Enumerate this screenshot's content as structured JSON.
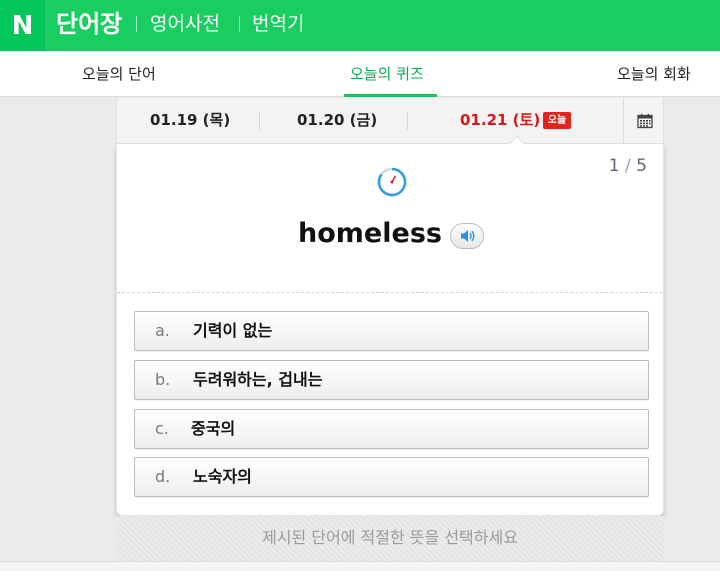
{
  "header": {
    "logo": "N",
    "title": "단어장",
    "links": [
      "영어사전",
      "번역기"
    ]
  },
  "subnav": {
    "items": [
      "오늘의 단어",
      "오늘의 퀴즈",
      "오늘의 회화"
    ],
    "active": "오늘의 퀴즈"
  },
  "dates": {
    "items": [
      "01.19 (목)",
      "01.20 (금)",
      "01.21 (토)"
    ],
    "today_badge": "오늘",
    "calendar_icon": "calendar-icon"
  },
  "quiz": {
    "current": "1",
    "total": "5",
    "word": "homeless",
    "sound_icon": "speaker-icon",
    "timer_icon": "timer-icon",
    "options": [
      {
        "letter": "a.",
        "text": "기력이 없는"
      },
      {
        "letter": "b.",
        "text": "두려워하는, 겁내는"
      },
      {
        "letter": "c.",
        "text": "중국의"
      },
      {
        "letter": "d.",
        "text": "노숙자의"
      }
    ],
    "hint": "제시된 단어에 적절한 뜻을 선택하세요"
  },
  "colors": {
    "brand_green": "#19ce60",
    "today_red": "#d9171b"
  }
}
